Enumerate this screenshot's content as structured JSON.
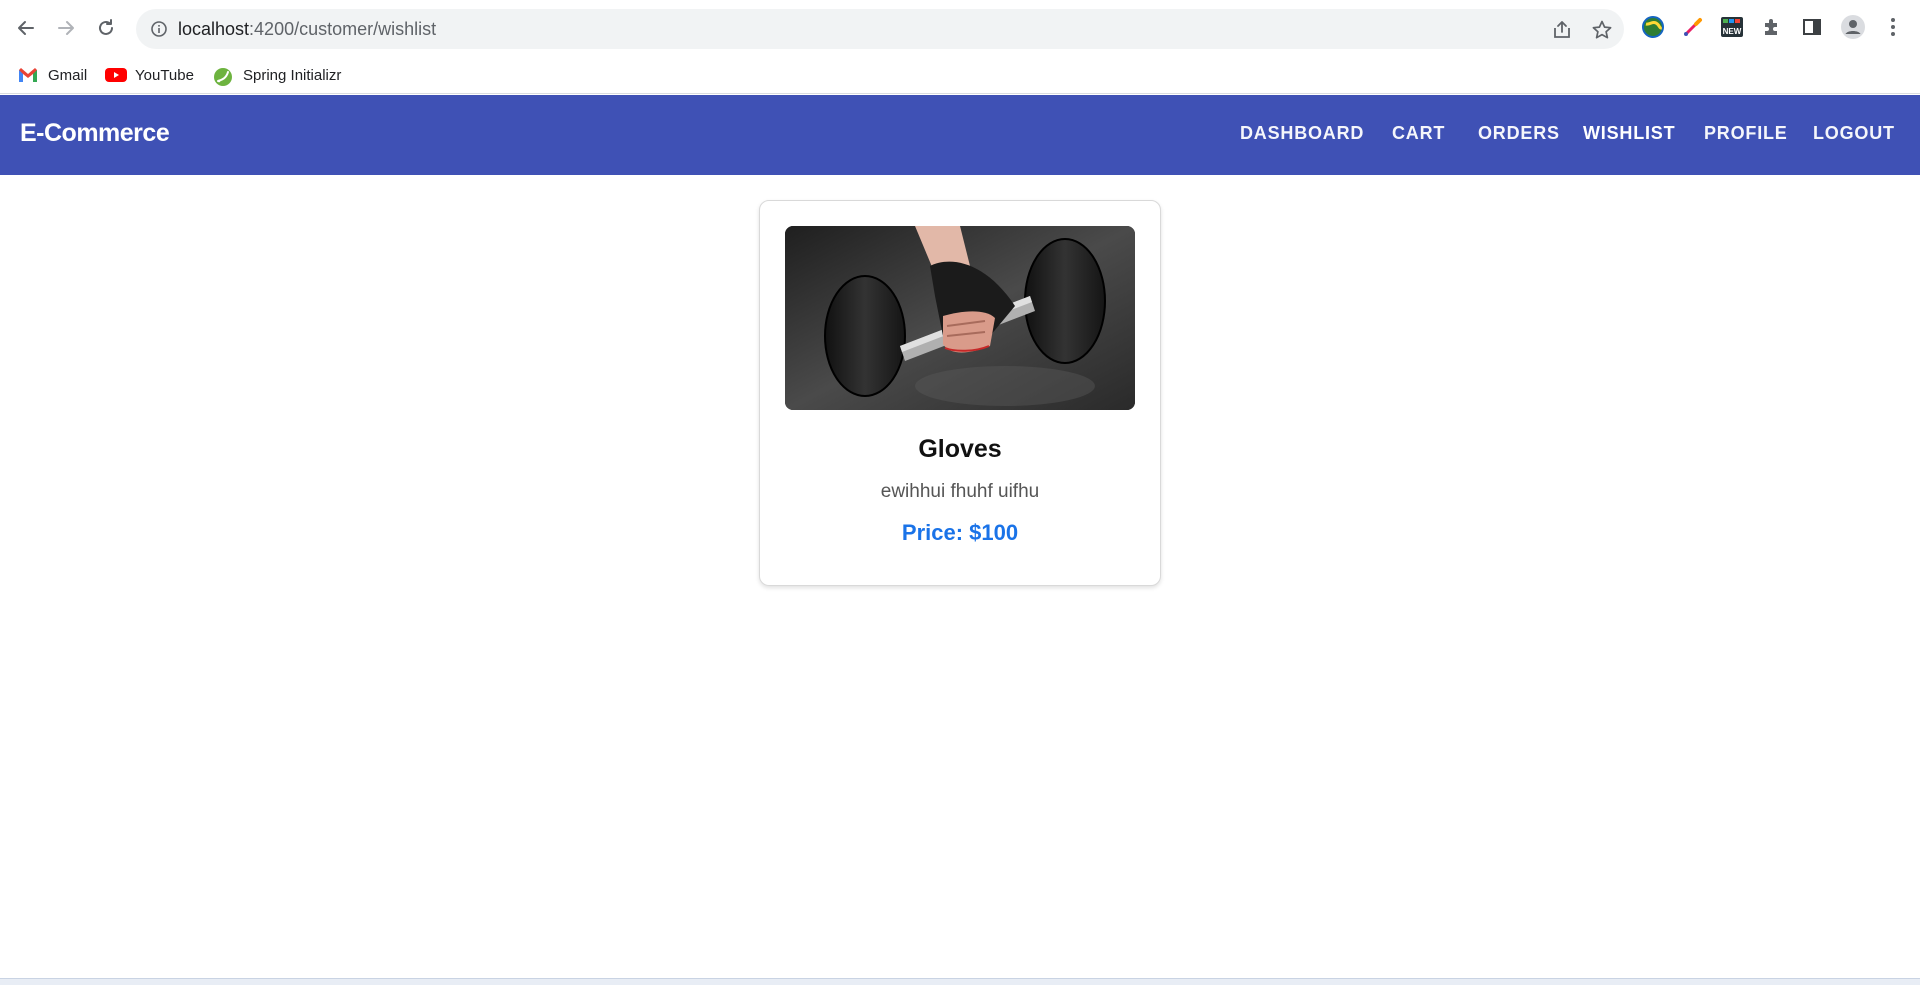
{
  "browser": {
    "url_host": "localhost",
    "url_path": ":4200/customer/wishlist",
    "bookmarks": [
      {
        "label": "Gmail",
        "icon": "gmail-icon"
      },
      {
        "label": "YouTube",
        "icon": "youtube-icon"
      },
      {
        "label": "Spring Initializr",
        "icon": "spring-icon"
      }
    ]
  },
  "navbar": {
    "brand": "E-Commerce",
    "items": [
      {
        "label": "DASHBOARD"
      },
      {
        "label": "CART"
      },
      {
        "label": "ORDERS"
      },
      {
        "label": "WISHLIST"
      },
      {
        "label": "PROFILE"
      },
      {
        "label": "LOGOUT"
      }
    ],
    "active": "WISHLIST",
    "color": "#3f51b5"
  },
  "wishlist": {
    "items": [
      {
        "name": "Gloves",
        "description": "ewihhui fhuhf uifhu",
        "price": "Price: $100",
        "image": "dumbbell-gloves-photo"
      }
    ]
  },
  "colors": {
    "price": "#1a73e8"
  }
}
